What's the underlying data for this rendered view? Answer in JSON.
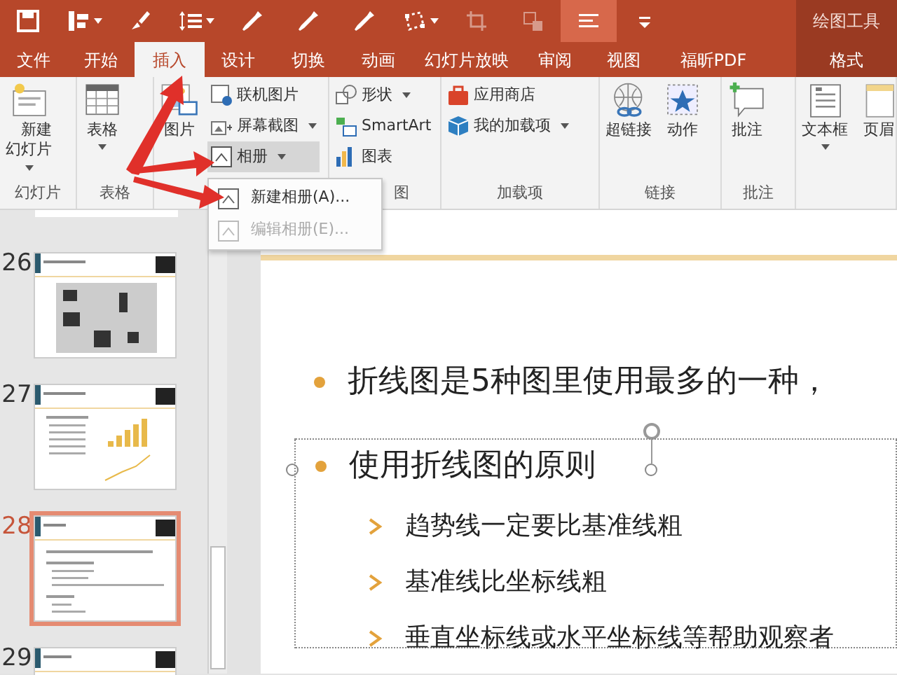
{
  "quick_access": [
    {
      "kind": "save",
      "disabled": false,
      "selected": false,
      "dropdown": false
    },
    {
      "kind": "layout",
      "disabled": false,
      "selected": false,
      "dropdown": true
    },
    {
      "kind": "brush",
      "disabled": false,
      "selected": false,
      "dropdown": false
    },
    {
      "kind": "spacing",
      "disabled": false,
      "selected": false,
      "dropdown": true
    },
    {
      "kind": "eyedropper",
      "disabled": false,
      "selected": false,
      "dropdown": false
    },
    {
      "kind": "eyedropper",
      "disabled": false,
      "selected": false,
      "dropdown": false
    },
    {
      "kind": "eyedropper",
      "disabled": false,
      "selected": false,
      "dropdown": false
    },
    {
      "kind": "points",
      "disabled": false,
      "selected": false,
      "dropdown": true
    },
    {
      "kind": "crop",
      "disabled": true,
      "selected": false,
      "dropdown": false
    },
    {
      "kind": "object",
      "disabled": true,
      "selected": false,
      "dropdown": false
    },
    {
      "kind": "align",
      "disabled": false,
      "selected": true,
      "dropdown": false
    },
    {
      "kind": "more",
      "disabled": false,
      "selected": false,
      "dropdown": false
    }
  ],
  "contextual_title": "绘图工具",
  "tabs": [
    {
      "label": "文件",
      "selected": false
    },
    {
      "label": "开始",
      "selected": false
    },
    {
      "label": "插入",
      "selected": true
    },
    {
      "label": "设计",
      "selected": false
    },
    {
      "label": "切换",
      "selected": false
    },
    {
      "label": "动画",
      "selected": false
    },
    {
      "label": "幻灯片放映",
      "selected": false
    },
    {
      "label": "审阅",
      "selected": false
    },
    {
      "label": "视图",
      "selected": false
    },
    {
      "label": "福昕PDF",
      "selected": false
    },
    {
      "label": "格式",
      "selected": false
    }
  ],
  "ribbon": {
    "groups": [
      {
        "label": "幻灯片",
        "large_buttons": [
          {
            "kind": "new-slide",
            "label": "新建幻灯片",
            "dropdown": true,
            "selected": false
          }
        ]
      },
      {
        "label": "表格",
        "large_buttons": [
          {
            "kind": "table",
            "label": "表格",
            "dropdown": true,
            "selected": false
          }
        ]
      },
      {
        "large_buttons": [
          {
            "kind": "picture",
            "label": "图片",
            "dropdown": false,
            "selected": false
          }
        ],
        "small_buttons": [
          {
            "kind": "online-picture",
            "label": "联机图片",
            "dropdown": false,
            "selected": false
          },
          {
            "kind": "screenshot",
            "label": "屏幕截图",
            "dropdown": true,
            "selected": false
          },
          {
            "kind": "album",
            "label": "相册",
            "dropdown": true,
            "selected": true
          }
        ]
      },
      {
        "label": "图",
        "small_buttons": [
          {
            "kind": "shapes",
            "label": "形状",
            "dropdown": true,
            "selected": false
          },
          {
            "kind": "smartart",
            "label": "SmartArt",
            "dropdown": false,
            "selected": false
          },
          {
            "kind": "chart",
            "label": "图表",
            "dropdown": false,
            "selected": false
          }
        ]
      },
      {
        "label": "加载项",
        "small_buttons": [
          {
            "kind": "store",
            "label": "应用商店",
            "dropdown": false,
            "selected": false
          },
          {
            "kind": "addins",
            "label": "我的加载项",
            "dropdown": true,
            "selected": false
          }
        ]
      },
      {
        "label": "链接",
        "large_buttons": [
          {
            "kind": "hyperlink",
            "label": "超链接",
            "dropdown": false,
            "selected": false
          },
          {
            "kind": "action",
            "label": "动作",
            "dropdown": false,
            "selected": false
          }
        ]
      },
      {
        "label": "批注",
        "large_buttons": [
          {
            "kind": "comment",
            "label": "批注",
            "dropdown": false,
            "selected": false
          }
        ]
      },
      {
        "large_buttons": [
          {
            "kind": "textbox",
            "label": "文本框",
            "dropdown": true,
            "selected": false
          },
          {
            "kind": "header",
            "label": "页眉",
            "dropdown": false,
            "selected": false
          }
        ]
      }
    ]
  },
  "album_menu": [
    {
      "label": "新建相册(A)...",
      "disabled": false
    },
    {
      "label": "编辑相册(E)...",
      "disabled": true
    }
  ],
  "thumbnails": [
    {
      "number": "26",
      "kind": "diagram",
      "selected": false
    },
    {
      "number": "27",
      "kind": "chart",
      "selected": false
    },
    {
      "number": "28",
      "kind": "text",
      "selected": true
    },
    {
      "number": "29",
      "kind": "title",
      "selected": false
    }
  ],
  "slide": {
    "text_box_selected": true,
    "bullets": [
      {
        "text": "折线图是5种图里使用最多的一种，"
      },
      {
        "text": "使用折线图的原则",
        "children": [
          {
            "text": "趋势线一定要比基准线粗"
          },
          {
            "text": "基准线比坐标线粗"
          },
          {
            "text": "垂直坐标线或水平坐标线等帮助观察者"
          }
        ]
      }
    ]
  }
}
